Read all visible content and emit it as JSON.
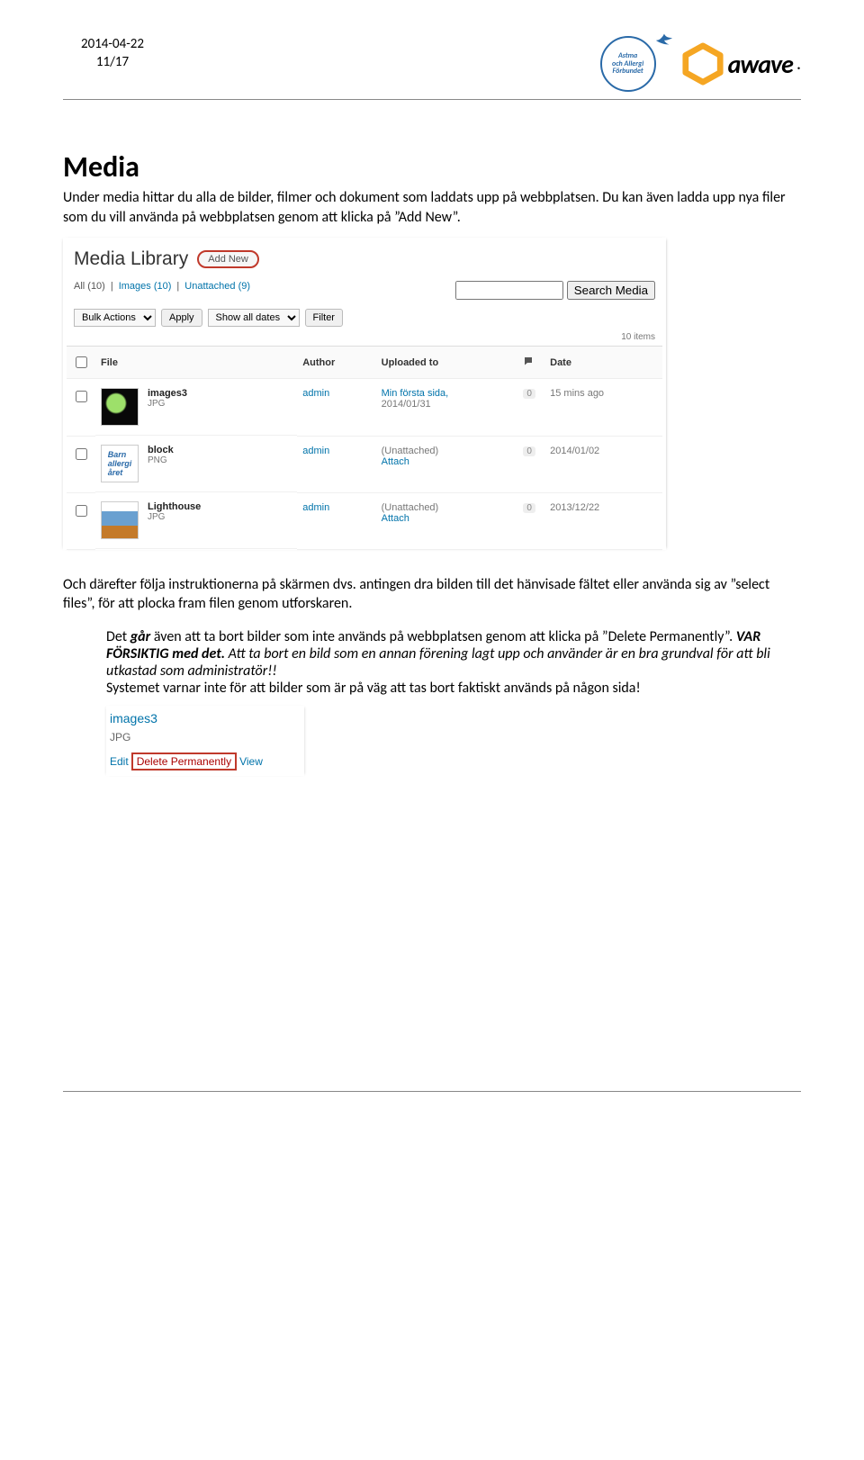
{
  "header": {
    "date": "2014-04-22",
    "page_of": "11/17",
    "astma_lines": "Astma\noch Allergi\nFörbundet",
    "awave_text": "awave"
  },
  "title": "Media",
  "intro": "Under media hittar du alla de bilder, filmer och dokument som laddats upp på webbplatsen. Du kan även ladda upp nya filer som du vill använda på webbplatsen genom att klicka på ”Add New”.",
  "media_library": {
    "title": "Media Library",
    "add_new": "Add New",
    "filters": {
      "all": "All (10)",
      "images": "Images (10)",
      "unattached": "Unattached (9)"
    },
    "toolbar": {
      "bulk": "Bulk Actions",
      "apply": "Apply",
      "dates": "Show all dates",
      "filter": "Filter",
      "search_btn": "Search Media",
      "items": "10 items"
    },
    "columns": {
      "file": "File",
      "author": "Author",
      "uploaded": "Uploaded to",
      "comments": "💬",
      "date": "Date"
    },
    "rows": [
      {
        "name": "images3",
        "type": "JPG",
        "author": "admin",
        "uploaded_a": "Min första sida,",
        "uploaded_b": "2014/01/31",
        "comments": "0",
        "date": "15 mins ago"
      },
      {
        "name": "block",
        "type": "PNG",
        "author": "admin",
        "uploaded_a": "(Unattached)",
        "uploaded_b": "Attach",
        "comments": "0",
        "date": "2014/01/02"
      },
      {
        "name": "Lighthouse",
        "type": "JPG",
        "author": "admin",
        "uploaded_a": "(Unattached)",
        "uploaded_b": "Attach",
        "comments": "0",
        "date": "2013/12/22"
      }
    ]
  },
  "mid_para": "Och därefter följa instruktionerna på skärmen dvs. antingen dra bilden till det hänvisade fältet eller använda sig av ”select files”, för att plocka fram filen genom utforskaren.",
  "warn": {
    "p1a": "Det ",
    "p1b": "går",
    "p1c": " även att ta bort bilder som inte används på webbplatsen genom att klicka på ”Delete Permanently”. ",
    "p1d": "VAR FÖRSIKTIG med det.",
    "p1e": " Att ta bort en bild som en annan förening lagt upp och använder är en bra grundval för att bli utkastad som administratör!!",
    "p2": "Systemet varnar inte för att bilder som är på väg att tas bort faktiskt används på någon sida!"
  },
  "delete_shot": {
    "name": "images3",
    "type": "JPG",
    "edit": "Edit",
    "del": "Delete Permanently",
    "view": "View"
  }
}
